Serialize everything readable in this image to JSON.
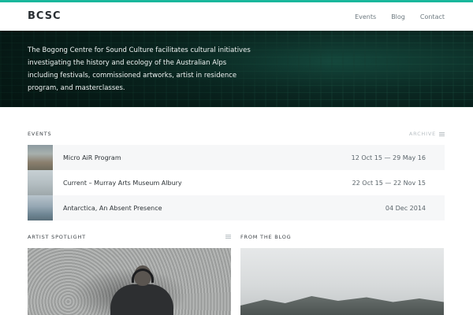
{
  "header": {
    "logo": "BCSC",
    "nav": [
      "Events",
      "Blog",
      "Contact"
    ]
  },
  "hero": {
    "text": "The Bogong Centre for Sound Culture facilitates cultural initiatives investigating the history and ecology of the Australian Alps including festivals, commissioned artworks, artist in residence program, and masterclasses."
  },
  "events": {
    "label": "EVENTS",
    "archive_label": "ARCHIVE",
    "items": [
      {
        "title": "Micro AiR Program",
        "date": "12 Oct 15 — 29 May 16"
      },
      {
        "title": "Current – Murray Arts Museum Albury",
        "date": "22 Oct 15 — 22 Nov 15"
      },
      {
        "title": "Antarctica, An Absent Presence",
        "date": "04 Dec 2014"
      }
    ]
  },
  "sections": {
    "spotlight_label": "ARTIST SPOTLIGHT",
    "blog_label": "FROM THE BLOG"
  },
  "colors": {
    "accent": "#19b79c",
    "hero_bg": "#0b2a24"
  }
}
